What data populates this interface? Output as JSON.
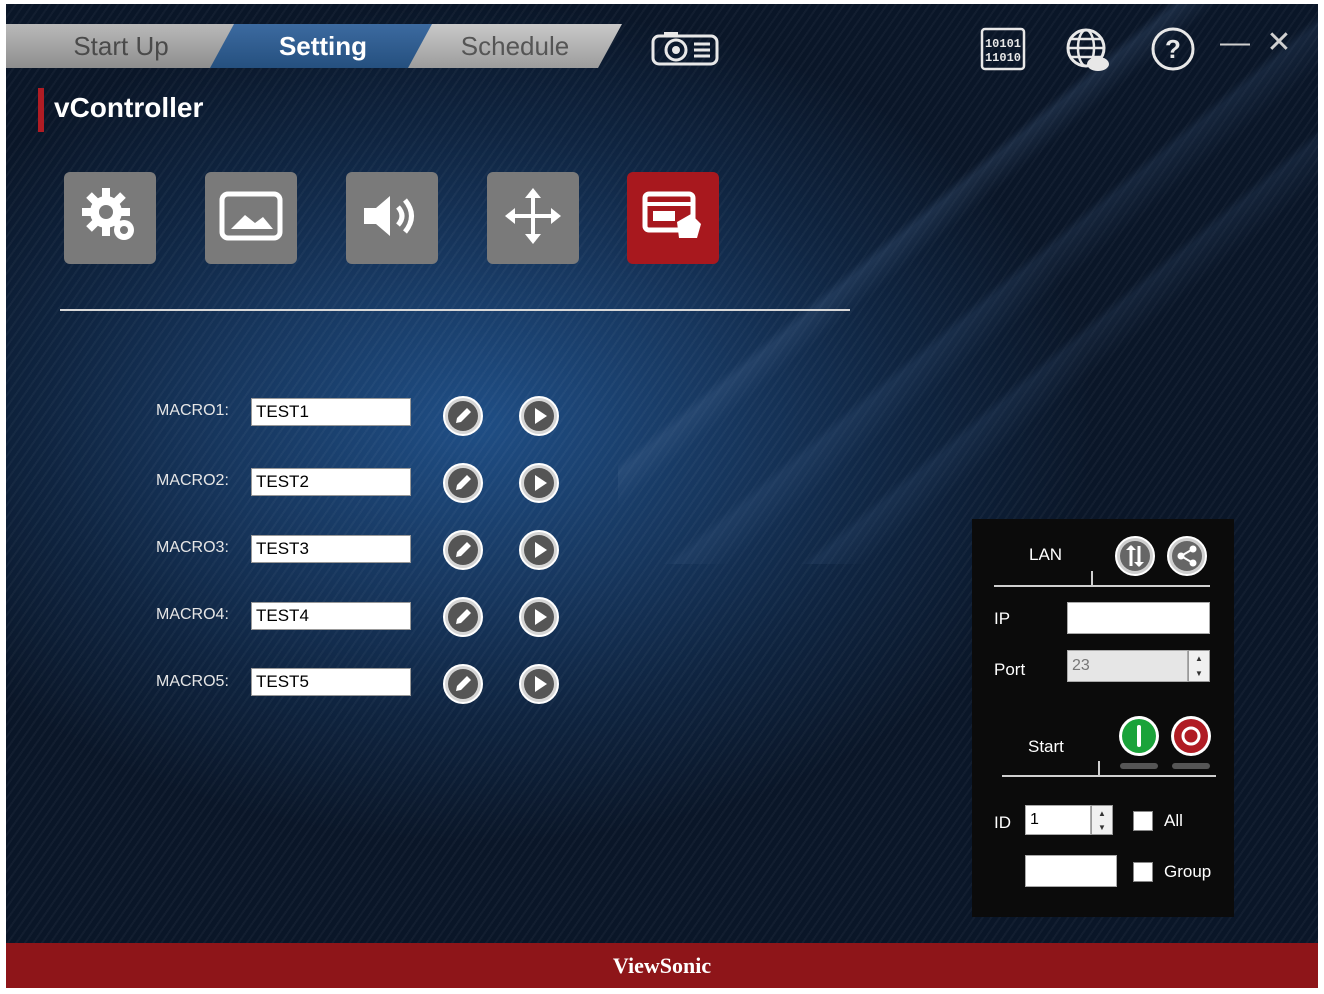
{
  "tabs": [
    {
      "label": "Start Up",
      "active": false
    },
    {
      "label": "Setting",
      "active": true
    },
    {
      "label": "Schedule",
      "active": false
    }
  ],
  "header_icons": [
    "projector-icon",
    "binary-code-icon",
    "globe-icon",
    "help-icon",
    "minimize-icon",
    "close-icon"
  ],
  "window_controls": {
    "minimize": "—",
    "close": "✕"
  },
  "app_title": "vController",
  "categories": [
    {
      "name": "gear-icon",
      "active": false
    },
    {
      "name": "picture-icon",
      "active": false
    },
    {
      "name": "speaker-icon",
      "active": false
    },
    {
      "name": "move-arrows-icon",
      "active": false
    },
    {
      "name": "macro-window-icon",
      "active": true
    }
  ],
  "macros": [
    {
      "label": "MACRO1:",
      "value": "TEST1"
    },
    {
      "label": "MACRO2:",
      "value": "TEST2"
    },
    {
      "label": "MACRO3:",
      "value": "TEST3"
    },
    {
      "label": "MACRO4:",
      "value": "TEST4"
    },
    {
      "label": "MACRO5:",
      "value": "TEST5"
    }
  ],
  "connection_panel": {
    "lan_label": "LAN",
    "ip_label": "IP",
    "ip_value": "",
    "port_label": "Port",
    "port_value": "23",
    "start_label": "Start",
    "id_label": "ID",
    "id_value": "1",
    "all_label": "All",
    "group_label": "Group",
    "group_value": ""
  },
  "footer": {
    "brand": "ViewSonic"
  },
  "colors": {
    "accent_red": "#a8181e",
    "tab_active": "#2f5d92",
    "start_green": "#1aa33a",
    "stop_red": "#b01c24"
  }
}
